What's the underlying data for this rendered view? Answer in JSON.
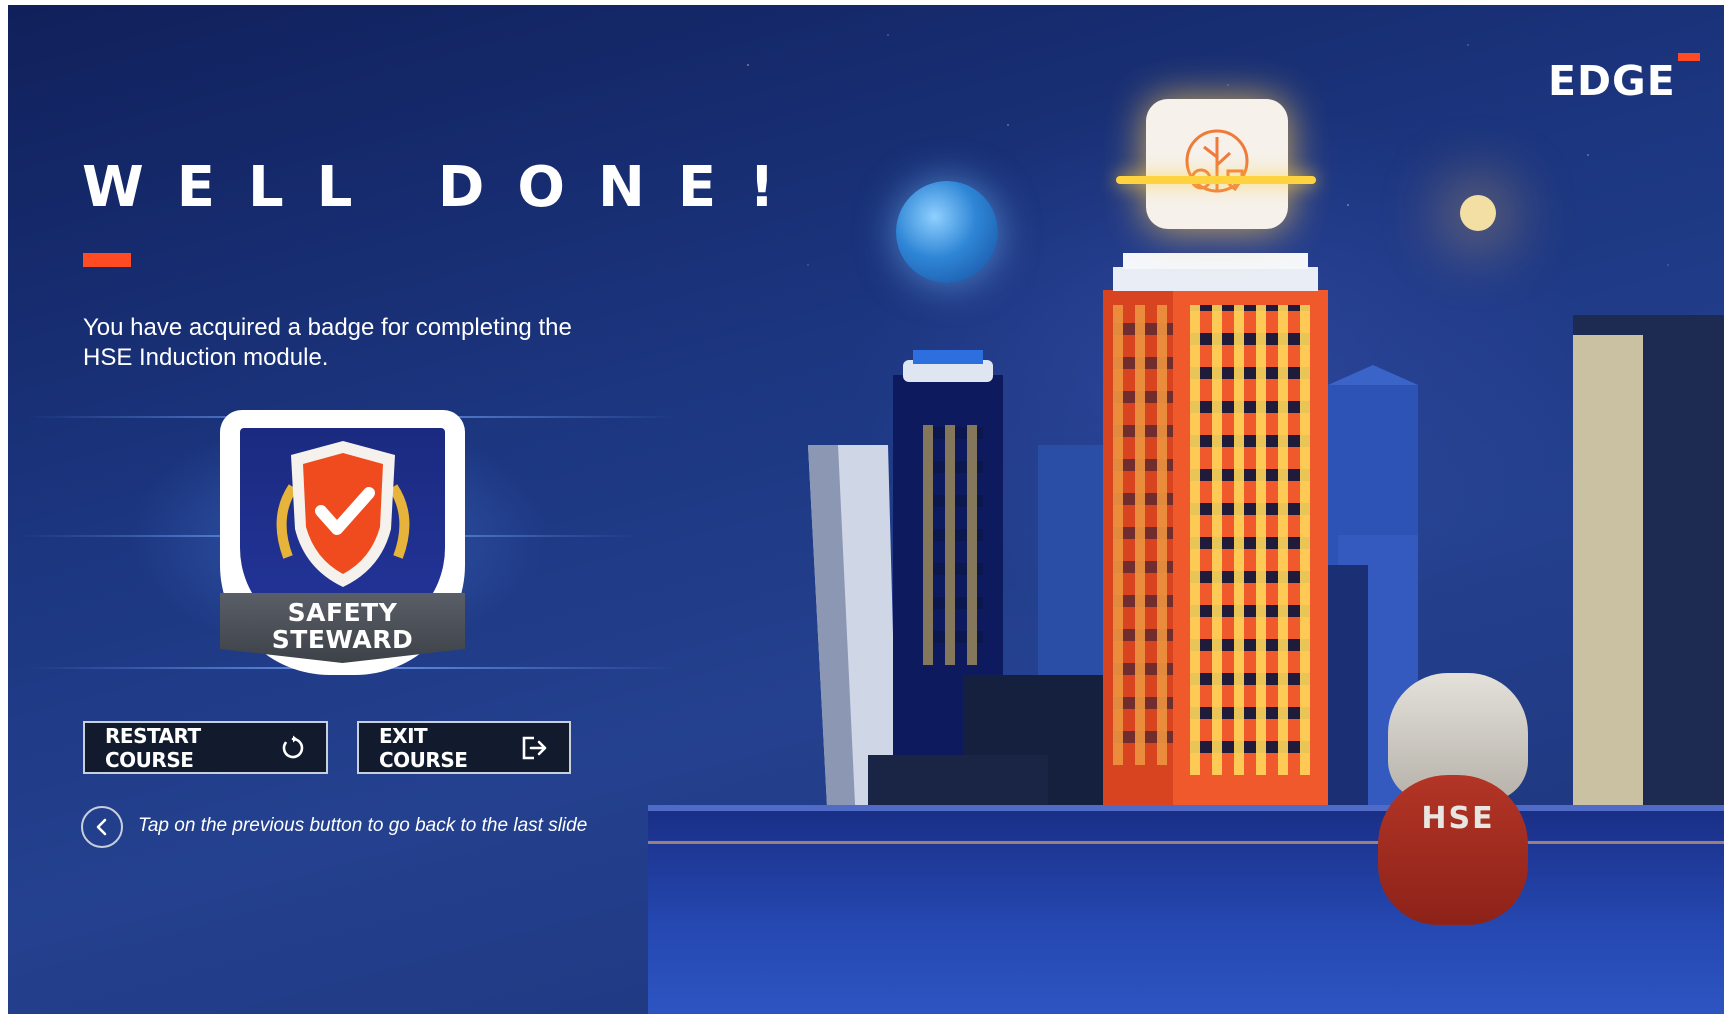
{
  "logo": {
    "text": "EDGE"
  },
  "heading": {
    "title": "WELL DONE!"
  },
  "message": {
    "text": "You have acquired a badge for completing the HSE Induction module."
  },
  "badge": {
    "line1": "SAFETY",
    "line2": "STEWARD"
  },
  "buttons": {
    "restart": {
      "label": "RESTART COURSE",
      "icon": "restart-icon"
    },
    "exit": {
      "label": "EXIT COURSE",
      "icon": "exit-icon"
    }
  },
  "navigation": {
    "previous_icon": "chevron-left-icon",
    "hint": "Tap on the previous button to go back to the last slide"
  },
  "scene": {
    "robot_label": "HSE"
  },
  "colors": {
    "accent": "#ff4b24",
    "background": "#1c3680",
    "button_bg": "#121a2e"
  }
}
